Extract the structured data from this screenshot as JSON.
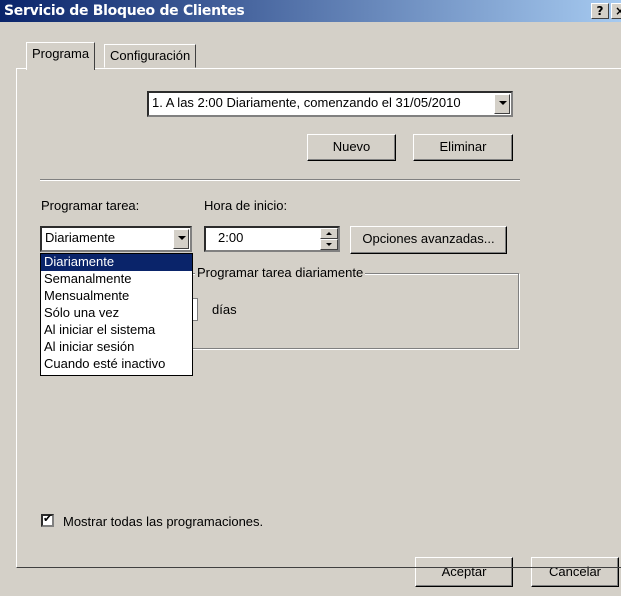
{
  "window": {
    "title": "Servicio de Bloqueo de Clientes",
    "help_label": "?",
    "close_label": "×"
  },
  "tabs": [
    {
      "label": "Programa"
    },
    {
      "label": "Configuración"
    }
  ],
  "schedule_combo": {
    "value": "1. A las 2:00 Diariamente, comenzando el 31/05/2010"
  },
  "buttons": {
    "nuevo": "Nuevo",
    "eliminar": "Eliminar",
    "opciones": "Opciones avanzadas...",
    "aceptar": "Aceptar",
    "cancelar": "Cancelar"
  },
  "labels": {
    "programar_tarea": "Programar tarea:",
    "hora_inicio": "Hora de inicio:",
    "dias": "días"
  },
  "task_combo": {
    "value": "Diariamente"
  },
  "start_time": {
    "value": "2:00"
  },
  "group": {
    "legend": "Programar tarea diariamente"
  },
  "task_options": [
    "Diariamente",
    "Semanalmente",
    "Mensualmente",
    "Sólo una vez",
    "Al iniciar el sistema",
    "Al iniciar sesión",
    "Cuando esté inactivo"
  ],
  "show_all": {
    "label": "Mostrar todas las programaciones.",
    "checked": true
  }
}
